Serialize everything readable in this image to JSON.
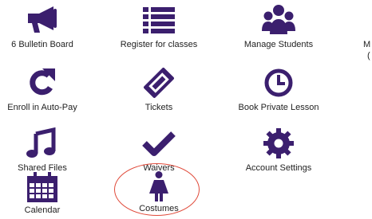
{
  "colors": {
    "icon": "#3b1f6e",
    "highlight": "#e04a3a"
  },
  "tiles": [
    {
      "label": "6 Bulletin Board",
      "icon": "megaphone-icon"
    },
    {
      "label": "Register for classes",
      "icon": "list-icon"
    },
    {
      "label": "Manage Students",
      "icon": "users-icon"
    },
    {
      "label": "M",
      "sub": "(",
      "icon": "partially-visible-icon"
    },
    {
      "label": "Enroll in Auto-Pay",
      "icon": "refresh-icon"
    },
    {
      "label": "Tickets",
      "icon": "ticket-icon"
    },
    {
      "label": "Book Private Lesson",
      "icon": "clock-icon"
    },
    {
      "label": "Shared Files",
      "icon": "music-note-icon"
    },
    {
      "label": "Waivers",
      "icon": "checkmark-icon"
    },
    {
      "label": "Account Settings",
      "icon": "gear-icon"
    },
    {
      "label": "Calendar",
      "icon": "calendar-icon"
    },
    {
      "label": "Costumes",
      "icon": "person-dress-icon"
    }
  ]
}
